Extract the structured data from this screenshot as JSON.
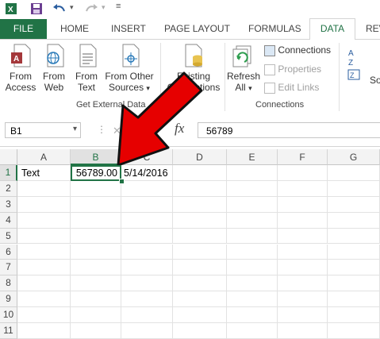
{
  "qat": {
    "save_icon": "save-icon",
    "undo_icon": "undo-icon",
    "redo_icon": "redo-icon"
  },
  "tabs": [
    "FILE",
    "HOME",
    "INSERT",
    "PAGE LAYOUT",
    "FORMULAS",
    "DATA",
    "REV"
  ],
  "ribbon": {
    "from_access": [
      "From",
      "Access"
    ],
    "from_web": [
      "From",
      "Web"
    ],
    "from_text": [
      "From",
      "Text"
    ],
    "from_other": [
      "From Other",
      "Sources"
    ],
    "existing": [
      "Existing",
      "Connections"
    ],
    "group_external": "Get External Data",
    "refresh": [
      "Refresh",
      "All"
    ],
    "connections": "Connections",
    "properties": "Properties",
    "edit_links": "Edit Links",
    "group_connections": "Connections",
    "sort_partial": "So"
  },
  "formula_bar": {
    "name_box": "B1",
    "fx": "fx",
    "value": "56789"
  },
  "columns": [
    "A",
    "B",
    "C",
    "D",
    "E",
    "F",
    "G"
  ],
  "rows": [
    "1",
    "2",
    "3",
    "4",
    "5",
    "6",
    "7",
    "8",
    "9",
    "10",
    "11"
  ],
  "cells": {
    "A1": "Text",
    "B1": "56789.00",
    "C1": "5/14/2016"
  },
  "colors": {
    "accent": "#217346",
    "arrow": "#e60000"
  }
}
